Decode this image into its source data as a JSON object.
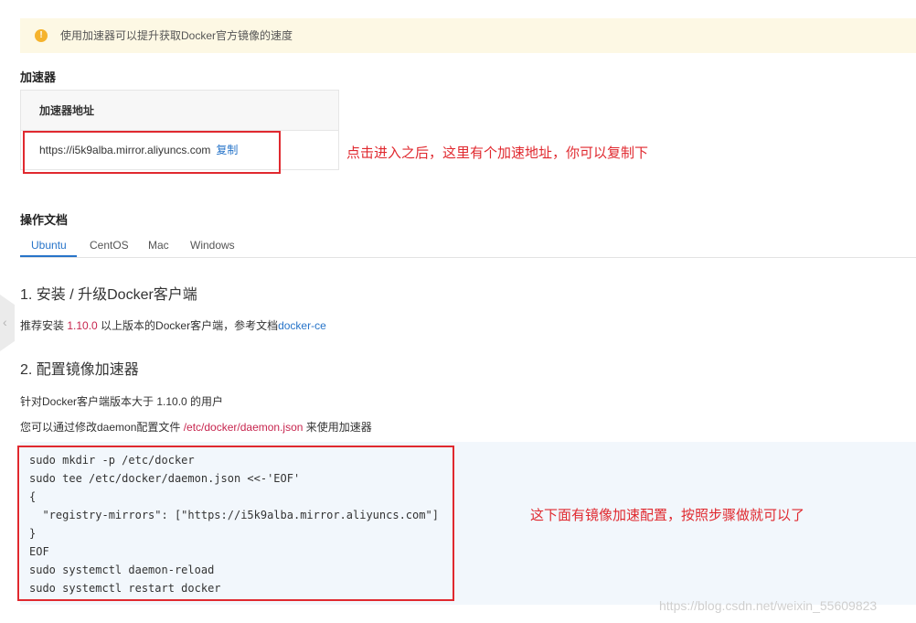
{
  "notice": {
    "text": "使用加速器可以提升获取Docker官方镜像的速度",
    "icon": "warning-icon"
  },
  "accelerator": {
    "section_title": "加速器",
    "table_header": "加速器地址",
    "address": "https://i5k9alba.mirror.aliyuncs.com",
    "copy_label": "复制",
    "annotation": "点击进入之后，这里有个加速地址，你可以复制下"
  },
  "docs": {
    "section_title": "操作文档",
    "tabs": [
      "Ubuntu",
      "CentOS",
      "Mac",
      "Windows"
    ],
    "active_tab": "Ubuntu"
  },
  "step1": {
    "title": "1. 安装 / 升级Docker客户端",
    "text_prefix": "推荐安装 ",
    "version": "1.10.0",
    "text_middle": " 以上版本的Docker客户端，参考文档",
    "link": "docker-ce"
  },
  "step2": {
    "title": "2. 配置镜像加速器",
    "line1": "针对Docker客户端版本大于 1.10.0 的用户",
    "line2_prefix": "您可以通过修改daemon配置文件 ",
    "line2_path": "/etc/docker/daemon.json",
    "line2_suffix": " 来使用加速器",
    "code": [
      "sudo mkdir -p /etc/docker",
      "sudo tee /etc/docker/daemon.json <<-'EOF'",
      "{",
      "  \"registry-mirrors\": [\"https://i5k9alba.mirror.aliyuncs.com\"]",
      "}",
      "EOF",
      "sudo systemctl daemon-reload",
      "sudo systemctl restart docker"
    ],
    "annotation": "这下面有镜像加速配置，按照步骤做就可以了"
  },
  "watermark": "https://blog.csdn.net/weixin_55609823",
  "colors": {
    "link": "#2774c9",
    "annotation": "#e0292f",
    "notice_bg": "#fdf8e4",
    "warning": "#f5b32d"
  }
}
